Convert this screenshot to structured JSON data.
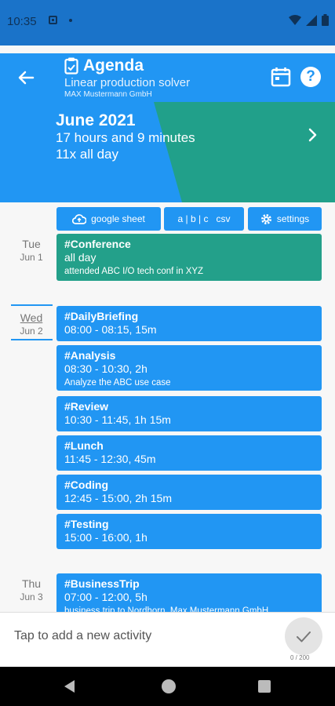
{
  "status": {
    "time": "10:35"
  },
  "appbar": {
    "title": "Agenda",
    "subtitle": "Linear production solver",
    "company": "MAX Mustermann GmbH",
    "help_label": "?"
  },
  "summary": {
    "month": "June 2021",
    "total_time": "17 hours and 9 minutes",
    "all_day_count": "11x all day"
  },
  "toolbar": {
    "google_sheet": "google sheet",
    "csv": "a | b | c   csv",
    "settings": "settings"
  },
  "days": [
    {
      "name": "Tue",
      "date": "Jun 1"
    },
    {
      "name": "Wed",
      "date": "Jun 2"
    },
    {
      "name": "Thu",
      "date": "Jun 3"
    }
  ],
  "events": [
    {
      "title": "#Conference",
      "time": "all day",
      "note": "attended ABC I/O tech conf in XYZ"
    },
    {
      "title": "#DailyBriefing",
      "time": "08:00 - 08:15, 15m"
    },
    {
      "title": "#Analysis",
      "time": "08:30 - 10:30, 2h",
      "note": "Analyze the ABC use case"
    },
    {
      "title": "#Review",
      "time": "10:30 - 11:45, 1h 15m"
    },
    {
      "title": "#Lunch",
      "time": "11:45 - 12:30, 45m"
    },
    {
      "title": "#Coding",
      "time": "12:45 - 15:00, 2h 15m"
    },
    {
      "title": "#Testing",
      "time": "15:00 - 16:00, 1h"
    },
    {
      "title": "#BusinessTrip",
      "time": "07:00 - 12:00, 5h",
      "note": "business trip to Nordhorn, Max Mustermann GmbH"
    }
  ],
  "input": {
    "placeholder": "Tap to add a new activity",
    "counter": "0 / 200"
  },
  "colors": {
    "primary": "#2196f3",
    "accent_green": "#23a08a",
    "status_bar": "#1a73c9"
  },
  "icons": {
    "back": "arrow-left-icon",
    "title": "clipboard-icon",
    "calendar": "calendar-icon",
    "help": "help-icon",
    "next": "chevron-right-icon",
    "sheet": "cloud-upload-icon",
    "settings": "gear-icon",
    "send": "check-icon"
  }
}
